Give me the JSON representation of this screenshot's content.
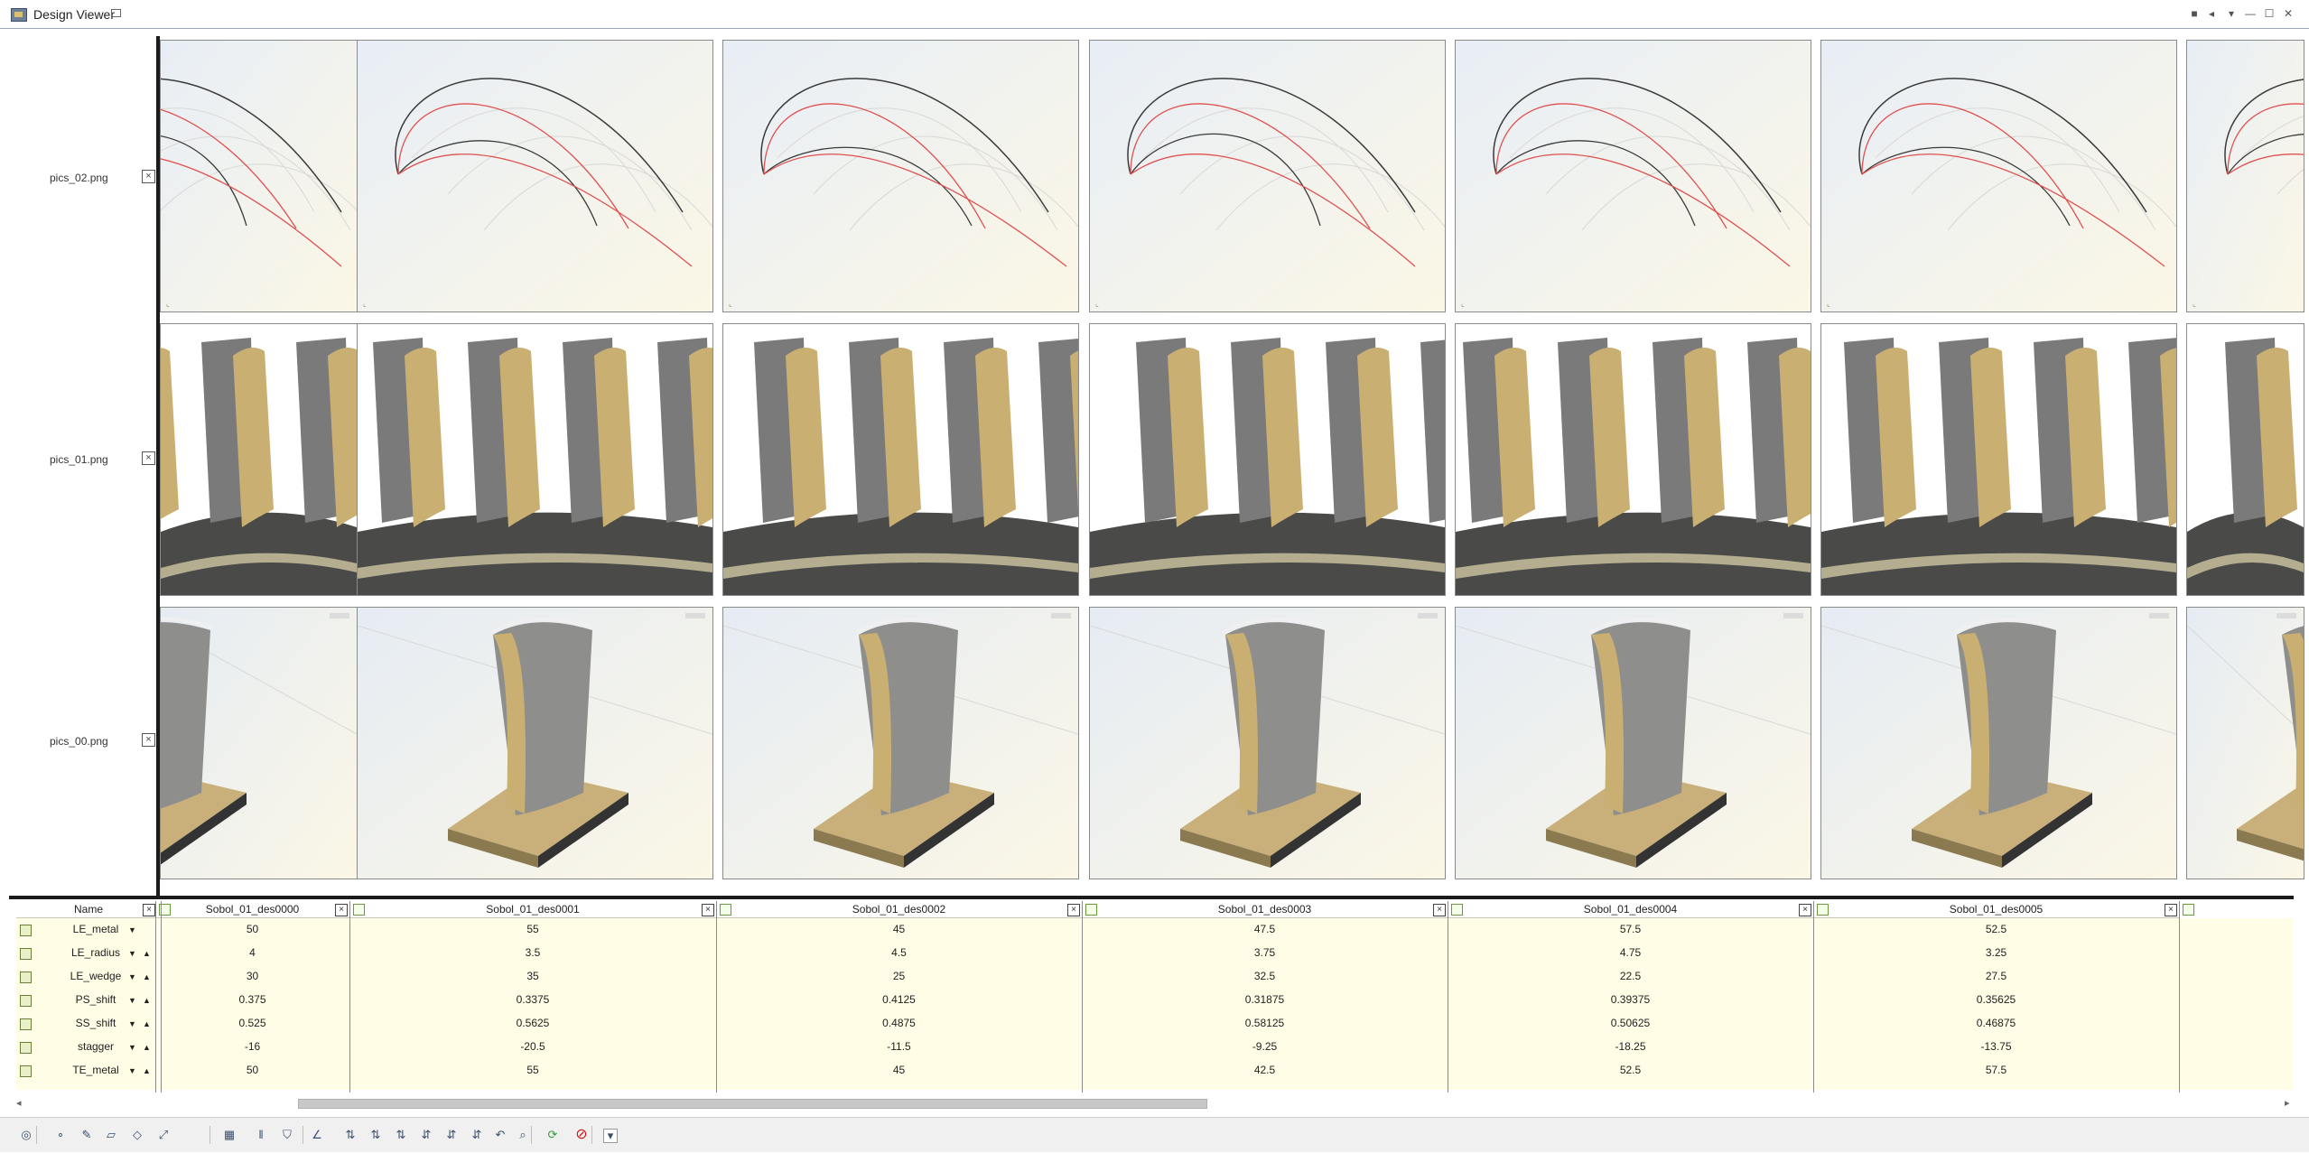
{
  "window": {
    "title": "Design Viewer",
    "controls": [
      "stop-icon",
      "prev-icon",
      "dropdown-icon",
      "minimize-icon",
      "maximize-icon",
      "close-icon"
    ]
  },
  "rows": [
    {
      "label": "pics_02.png",
      "kind": "profile"
    },
    {
      "label": "pics_01.png",
      "kind": "cascade"
    },
    {
      "label": "pics_00.png",
      "kind": "blade"
    }
  ],
  "table": {
    "name_header": "Name",
    "columns": [
      "Sobol_01_des0000",
      "Sobol_01_des0001",
      "Sobol_01_des0002",
      "Sobol_01_des0003",
      "Sobol_01_des0004",
      "Sobol_01_des0005"
    ],
    "params": [
      {
        "name": "LE_metal",
        "values": [
          "50",
          "55",
          "45",
          "47.5",
          "57.5",
          "52.5"
        ]
      },
      {
        "name": "LE_radius",
        "values": [
          "4",
          "3.5",
          "4.5",
          "3.75",
          "4.75",
          "3.25"
        ]
      },
      {
        "name": "LE_wedge",
        "values": [
          "30",
          "35",
          "25",
          "32.5",
          "22.5",
          "27.5"
        ]
      },
      {
        "name": "PS_shift",
        "values": [
          "0.375",
          "0.3375",
          "0.4125",
          "0.31875",
          "0.39375",
          "0.35625"
        ]
      },
      {
        "name": "SS_shift",
        "values": [
          "0.525",
          "0.5625",
          "0.4875",
          "0.58125",
          "0.50625",
          "0.46875"
        ]
      },
      {
        "name": "stagger",
        "values": [
          "-16",
          "-20.5",
          "-11.5",
          "-9.25",
          "-18.25",
          "-13.75"
        ]
      },
      {
        "name": "TE_metal",
        "values": [
          "50",
          "55",
          "45",
          "42.5",
          "52.5",
          "57.5"
        ]
      }
    ]
  },
  "colors": {
    "profile_red": "#e05050",
    "profile_dark": "#3a3a3a",
    "blade_gold": "#c9b072",
    "blade_gray": "#7a7a7a",
    "table_bg": "#fffde6"
  },
  "toolbar": {
    "icons": [
      "settings-icon",
      "point-icon",
      "pencil-icon",
      "surface-icon",
      "solid-icon",
      "curve-icon",
      "grid-icon",
      "split-icon",
      "shape-icon",
      "angle-icon",
      "sort-x1-icon",
      "sort-x2-icon",
      "sort-x3-icon",
      "sort-y1-icon",
      "sort-y2-icon",
      "sort-y3-icon",
      "undo-icon",
      "zoom-icon",
      "refresh-icon",
      "stop-icon",
      "more-icon"
    ]
  }
}
